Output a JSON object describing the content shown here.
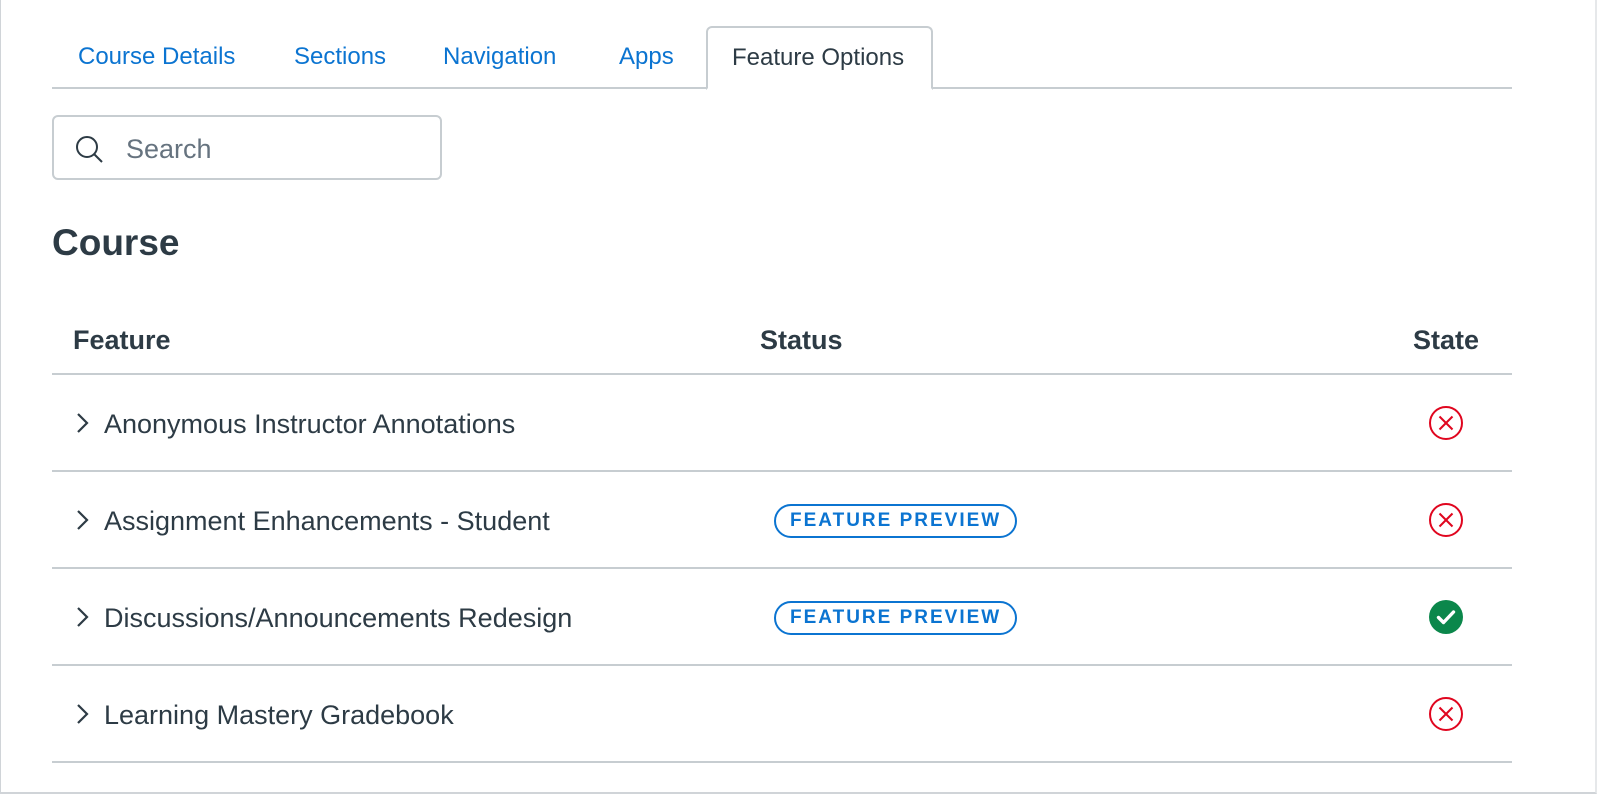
{
  "tabs": [
    {
      "label": "Course Details",
      "active": false
    },
    {
      "label": "Sections",
      "active": false
    },
    {
      "label": "Navigation",
      "active": false
    },
    {
      "label": "Apps",
      "active": false
    },
    {
      "label": "Feature Options",
      "active": true
    }
  ],
  "search": {
    "placeholder": "Search",
    "value": "",
    "icon": "search-icon"
  },
  "section_title": "Course",
  "table": {
    "headers": {
      "feature": "Feature",
      "status": "Status",
      "state": "State"
    },
    "rows": [
      {
        "feature": "Anonymous Instructor Annotations",
        "status": "",
        "state": "disabled",
        "state_icon": "x-circle-icon"
      },
      {
        "feature": "Assignment Enhancements - Student",
        "status": "FEATURE PREVIEW",
        "state": "disabled",
        "state_icon": "x-circle-icon"
      },
      {
        "feature": "Discussions/Announcements Redesign",
        "status": "FEATURE PREVIEW",
        "state": "enabled",
        "state_icon": "check-circle-icon"
      },
      {
        "feature": "Learning Mastery Gradebook",
        "status": "",
        "state": "disabled",
        "state_icon": "x-circle-icon"
      }
    ]
  },
  "colors": {
    "link": "#0b74d1",
    "text": "#2d3b45",
    "disabled_state": "#e0061f",
    "enabled_state": "#0b874b",
    "border": "#c7cdd1"
  }
}
